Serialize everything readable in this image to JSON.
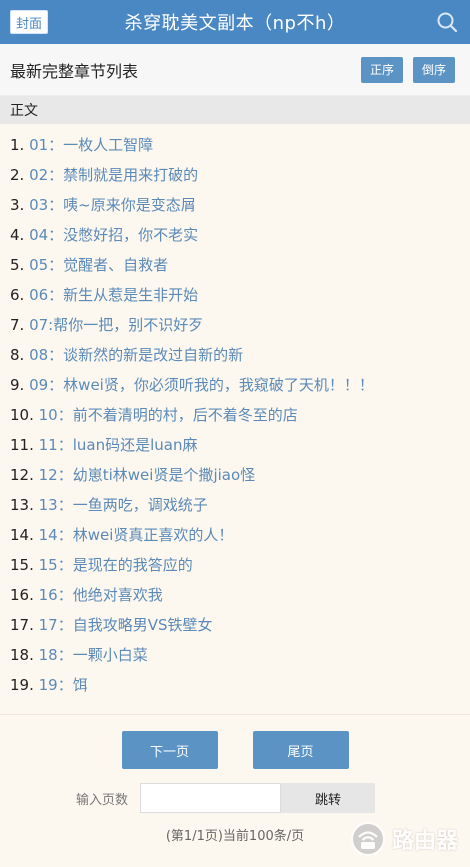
{
  "header": {
    "cover_label": "封面",
    "title": "杀穿耽美文副本（np不h）",
    "icon": "search-icon"
  },
  "list_header": {
    "title": "最新完整章节列表",
    "asc_label": "正序",
    "desc_label": "倒序"
  },
  "section_label": "正文",
  "chapters": [
    {
      "n": "1.",
      "t": "01：一枚人工智障"
    },
    {
      "n": "2.",
      "t": "02：禁制就是用来打破的"
    },
    {
      "n": "3.",
      "t": "03：咦~原来你是变态屑"
    },
    {
      "n": "4.",
      "t": "04：没憋好招，你不老实"
    },
    {
      "n": "5.",
      "t": "05：觉醒者、自救者"
    },
    {
      "n": "6.",
      "t": "06：新生从惹是生非开始"
    },
    {
      "n": "7.",
      "t": "07:帮你一把，别不识好歹"
    },
    {
      "n": "8.",
      "t": "08：谈新然的新是改过自新的新"
    },
    {
      "n": "9.",
      "t": "09：林wei贤，你必须听我的，我窥破了天机！！！"
    },
    {
      "n": "10.",
      "t": "10：前不着清明的村，后不着冬至的店"
    },
    {
      "n": "11.",
      "t": "11：luan码还是luan麻"
    },
    {
      "n": "12.",
      "t": "12：幼崽ti林wei贤是个撒jiao怪"
    },
    {
      "n": "13.",
      "t": "13：一鱼两吃，调戏统子"
    },
    {
      "n": "14.",
      "t": "14：林wei贤真正喜欢的人！"
    },
    {
      "n": "15.",
      "t": "15：是现在的我答应的"
    },
    {
      "n": "16.",
      "t": "16：他绝对喜欢我"
    },
    {
      "n": "17.",
      "t": "17：自我攻略男VS铁壁女"
    },
    {
      "n": "18.",
      "t": "18：一颗小白菜"
    },
    {
      "n": "19.",
      "t": "19：饵"
    }
  ],
  "pager": {
    "next_label": "下一页",
    "last_label": "尾页",
    "jump_label": "输入页数",
    "jump_value": "",
    "jump_button": "跳转",
    "info": "(第1/1页)当前100条/页"
  },
  "watermark": {
    "text": "路由器",
    "icon": "router-logo-icon"
  },
  "colors": {
    "topbar": "#4a88c4",
    "link": "#5b8ab8",
    "button": "#5b93c4",
    "background": "#fdf8ef"
  }
}
